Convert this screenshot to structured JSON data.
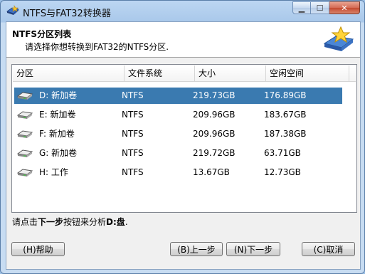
{
  "window": {
    "title": "NTFS与FAT32转换器",
    "minimize_glyph": "▁",
    "maximize_glyph": "☐",
    "close_glyph": "✕"
  },
  "header": {
    "title": "NTFS分区列表",
    "subtitle": "请选择你想转换到FAT32的NTFS分区."
  },
  "table": {
    "columns": [
      "分区",
      "文件系统",
      "大小",
      "空闲空间"
    ],
    "rows": [
      {
        "partition": "D: 新加卷",
        "fs": "NTFS",
        "size": "219.73GB",
        "free": "176.89GB"
      },
      {
        "partition": "E: 新加卷",
        "fs": "NTFS",
        "size": "209.96GB",
        "free": "183.67GB"
      },
      {
        "partition": "F: 新加卷",
        "fs": "NTFS",
        "size": "209.96GB",
        "free": "187.38GB"
      },
      {
        "partition": "G: 新加卷",
        "fs": "NTFS",
        "size": "219.72GB",
        "free": "63.71GB"
      },
      {
        "partition": "H: 工作",
        "fs": "NTFS",
        "size": "13.67GB",
        "free": "12.73GB"
      }
    ],
    "selected_row": 0
  },
  "status": {
    "prefix": "请点击",
    "bold1": "下一步",
    "middle": "按钮来分析",
    "bold2": "D:盘",
    "suffix": "."
  },
  "buttons": {
    "help": "(H)帮助",
    "back": "(B)上一步",
    "next": "(N)下一步",
    "cancel": "(C)取消"
  },
  "icons": {
    "app": "ntfs-convert-icon",
    "header": "star-disk-icon",
    "drive": "hard-drive-icon"
  },
  "colors": {
    "selection": "#3a7ab0",
    "frame": "#a9c8ea"
  }
}
